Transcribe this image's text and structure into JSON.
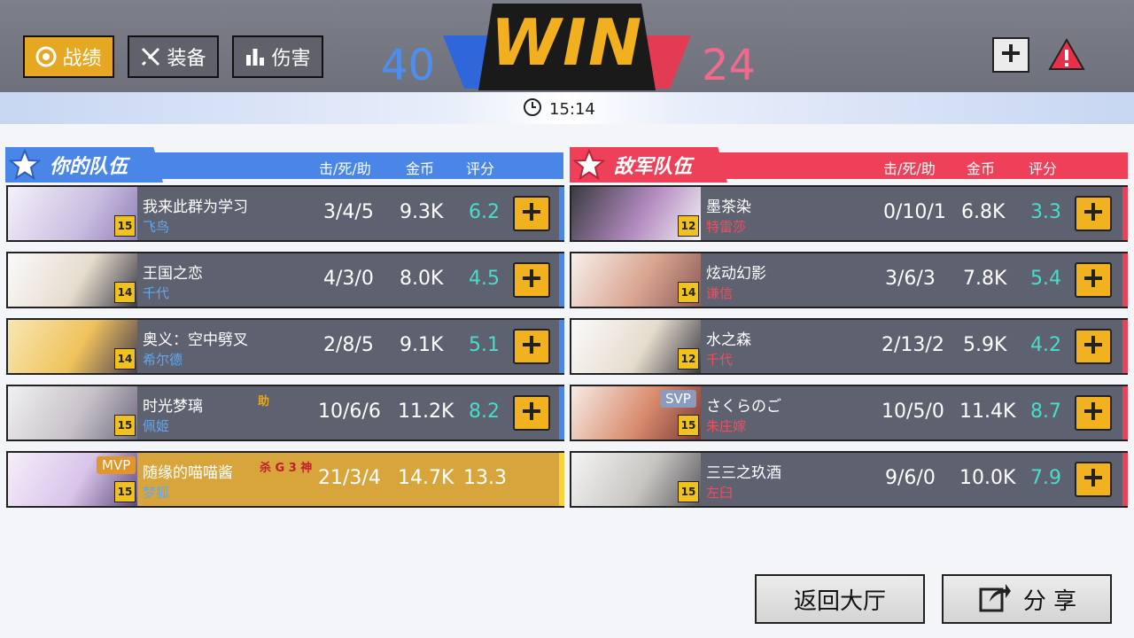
{
  "tabs": [
    {
      "label": "战绩",
      "icon": "target-icon",
      "active": true
    },
    {
      "label": "装备",
      "icon": "equipment-icon",
      "active": false
    },
    {
      "label": "伤害",
      "icon": "bar-chart-icon",
      "active": false
    }
  ],
  "result": {
    "text": "WIN",
    "score_blue": "40",
    "score_red": "24"
  },
  "timer": {
    "icon": "clock-icon",
    "value": "15:14"
  },
  "headers": {
    "kda": "击/死/助",
    "gold": "金币",
    "rating": "评分"
  },
  "your_team": {
    "title": "你的队伍",
    "color": "#4a86e8",
    "players": [
      {
        "name": "我来此群为学习",
        "hero": "飞鸟",
        "level": "15",
        "kda": "3/4/5",
        "gold": "9.3K",
        "rating": "6.2",
        "badge": "",
        "honors": ""
      },
      {
        "name": "王国之恋",
        "hero": "千代",
        "level": "14",
        "kda": "4/3/0",
        "gold": "8.0K",
        "rating": "4.5",
        "badge": "",
        "honors": ""
      },
      {
        "name": "奥义：空中劈叉",
        "hero": "希尔德",
        "level": "14",
        "kda": "2/8/5",
        "gold": "9.1K",
        "rating": "5.1",
        "badge": "",
        "honors": ""
      },
      {
        "name": "时光梦璃",
        "hero": "佩姬",
        "level": "15",
        "kda": "10/6/6",
        "gold": "11.2K",
        "rating": "8.2",
        "badge": "",
        "honors": "助"
      },
      {
        "name": "随缘的喵喵酱",
        "hero": "梦狐",
        "level": "15",
        "kda": "21/3/4",
        "gold": "14.7K",
        "rating": "13.3",
        "badge": "MVP",
        "honors": "杀 G 3 神"
      }
    ]
  },
  "enemy_team": {
    "title": "敌军队伍",
    "color": "#ee4058",
    "players": [
      {
        "name": "墨茶染",
        "hero": "特雷莎",
        "level": "12",
        "kda": "0/10/1",
        "gold": "6.8K",
        "rating": "3.3",
        "badge": ""
      },
      {
        "name": "炫动幻影",
        "hero": "谦信",
        "level": "14",
        "kda": "3/6/3",
        "gold": "7.8K",
        "rating": "5.4",
        "badge": ""
      },
      {
        "name": "水之森",
        "hero": "千代",
        "level": "12",
        "kda": "2/13/2",
        "gold": "5.9K",
        "rating": "4.2",
        "badge": ""
      },
      {
        "name": "さくらのご",
        "hero": "朱庄嫁",
        "level": "15",
        "kda": "10/5/0",
        "gold": "11.4K",
        "rating": "8.7",
        "badge": "SVP"
      },
      {
        "name": "三三之玖酒",
        "hero": "左臼",
        "level": "15",
        "kda": "9/6/0",
        "gold": "10.0K",
        "rating": "7.9",
        "badge": ""
      }
    ]
  },
  "buttons": {
    "lobby": "返回大厅",
    "share": "分 享"
  }
}
